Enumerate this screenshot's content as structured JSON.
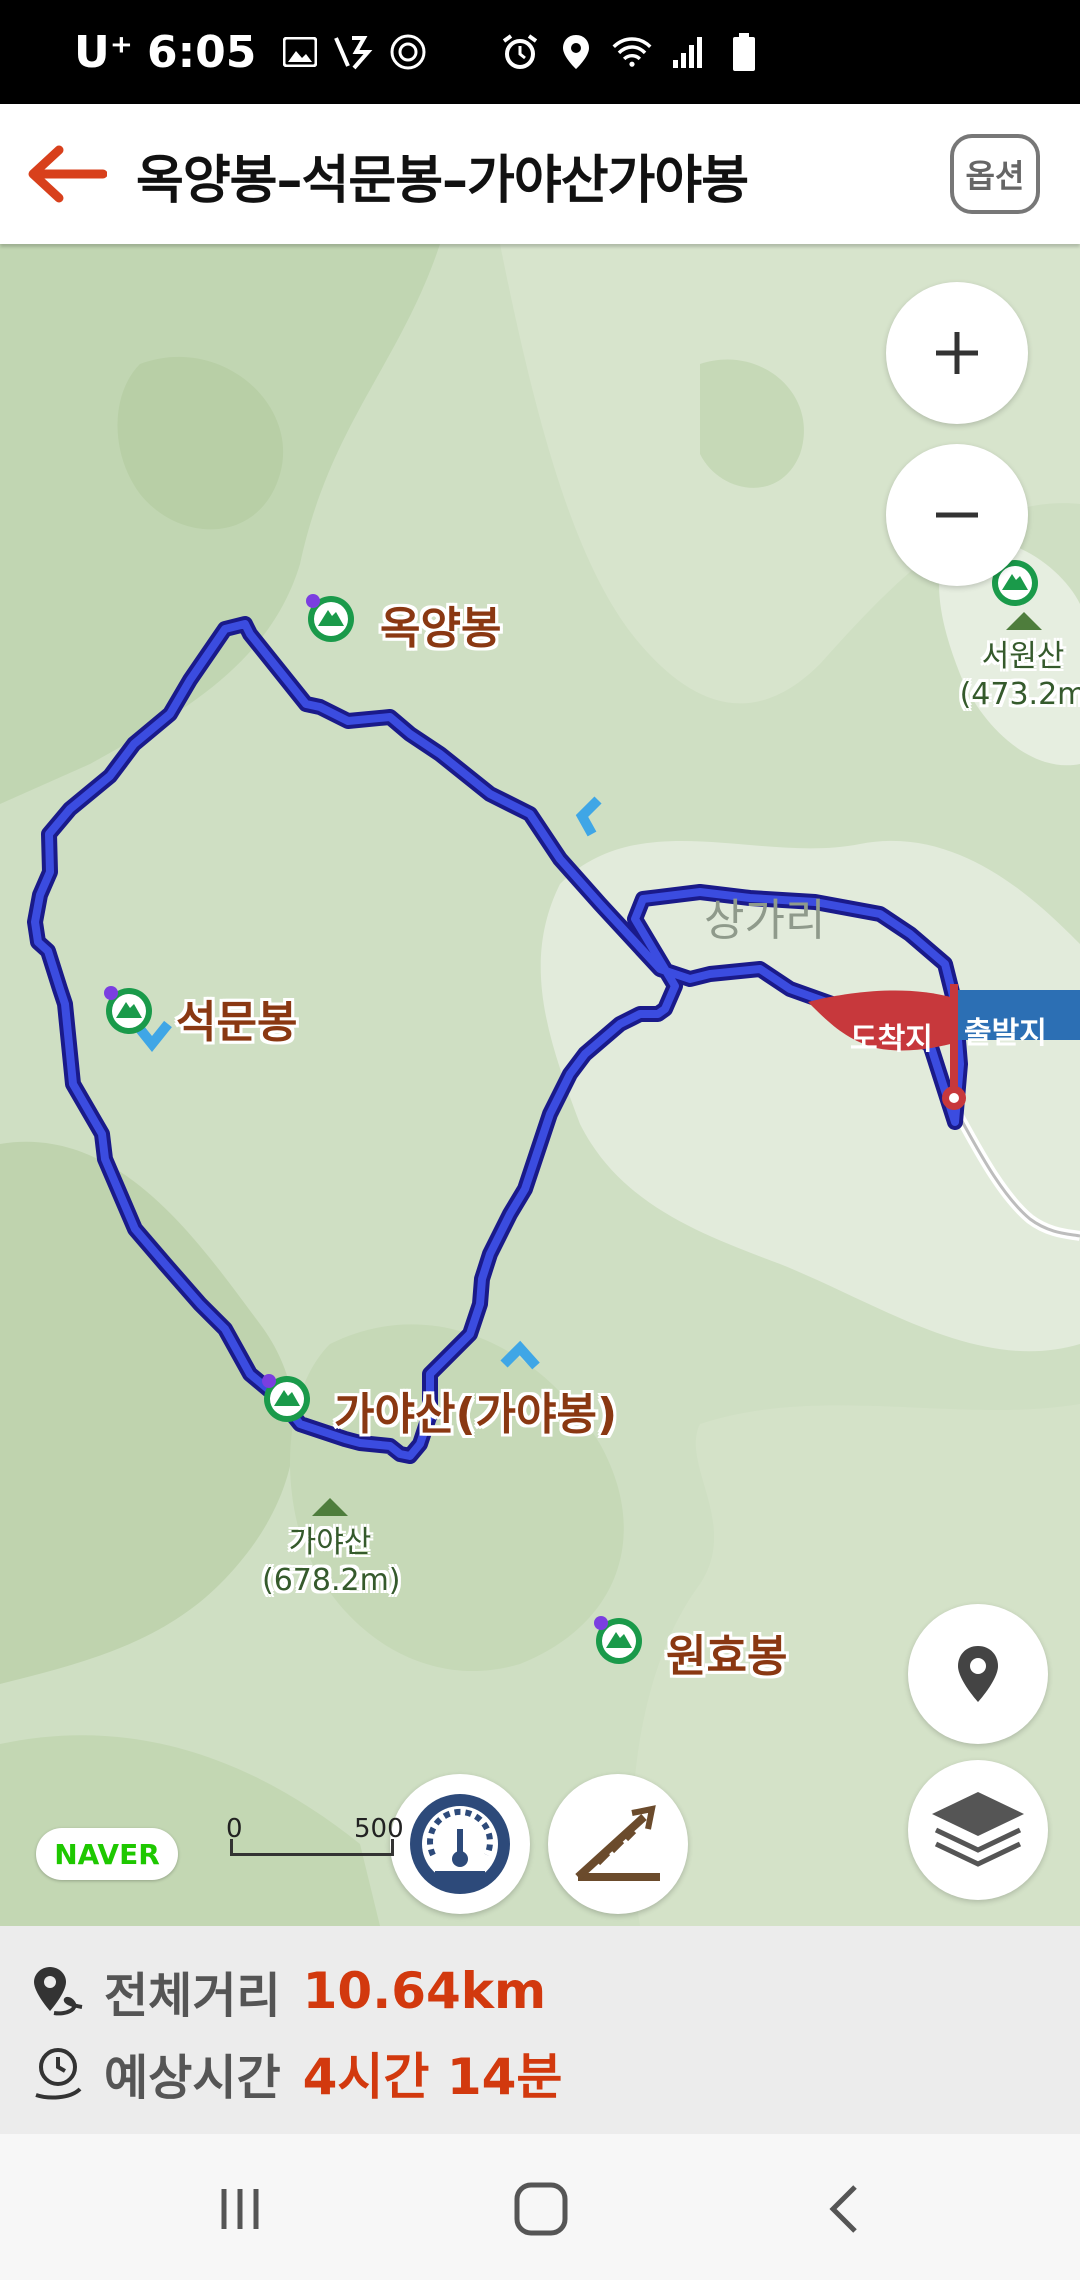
{
  "status_bar": {
    "carrier": "U⁺",
    "time": "6:05",
    "icons": [
      "image-icon",
      "flash-icon",
      "aperture-icon",
      "alarm-icon",
      "location-icon",
      "wifi-icon",
      "signal-icon",
      "battery-icon"
    ]
  },
  "header": {
    "title": "옥양봉–석문봉–가야산가야봉",
    "option_label": "옵션",
    "back_icon": "back-arrow-icon"
  },
  "map": {
    "peaks": [
      {
        "name": "옥양봉"
      },
      {
        "name": "석문봉"
      },
      {
        "name": "가야산(가야봉)"
      },
      {
        "name": "원효봉"
      }
    ],
    "mountains": [
      {
        "name": "가야산",
        "elevation": "(678.2m)"
      },
      {
        "name": "서원산",
        "elevation": "(473.2m"
      }
    ],
    "village": "상가리",
    "arrival_flag": "도착지",
    "departure_flag": "출발지",
    "zoom_in_icon": "plus-icon",
    "zoom_out_icon": "minus-icon",
    "location_icon": "location-pin-icon",
    "layers_icon": "layers-icon",
    "speed_icon": "speedometer-icon",
    "altitude_icon": "elevation-icon",
    "brand": "NAVER",
    "scale": {
      "start": "0",
      "end": "500"
    },
    "colors": {
      "route": "#2f3fd6",
      "terrain": "#cfdfc3",
      "arrival": "#c7383c",
      "departure": "#2c6fb4",
      "peak_marker": "#1a9a4a"
    }
  },
  "info": {
    "distance_label": "전체거리",
    "distance_value": "10.64km",
    "time_label": "예상시간",
    "time_value": "4시간 14분"
  },
  "nav_bar": {
    "recents_icon": "recents-icon",
    "home_icon": "home-icon",
    "back_icon": "back-chevron-icon"
  }
}
